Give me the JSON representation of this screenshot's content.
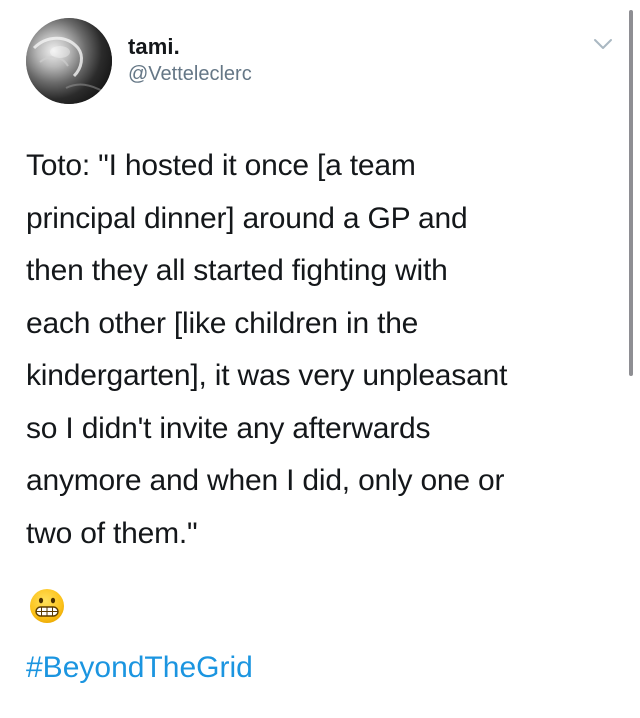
{
  "tweet": {
    "display_name": "tami.",
    "handle": "@Vetteleclerc",
    "text": "Toto: \"I hosted it once [a team\nprincipal dinner] around a GP and\nthen they all started fighting with\neach other [like children in the\nkindergarten], it was very unpleasant\nso I didn't invite any afterwards\nanymore and when I did, only one or\ntwo of them.\"",
    "emoji": "grimacing-face",
    "hashtag": "#BeyondTheGrid",
    "icons": {
      "more": "chevron-down-icon"
    }
  },
  "colors": {
    "text": "#14171a",
    "handle": "#657786",
    "hashtag": "#1b95e0",
    "caret": "#aab8c2",
    "scrollbar": "#8e8e93"
  }
}
